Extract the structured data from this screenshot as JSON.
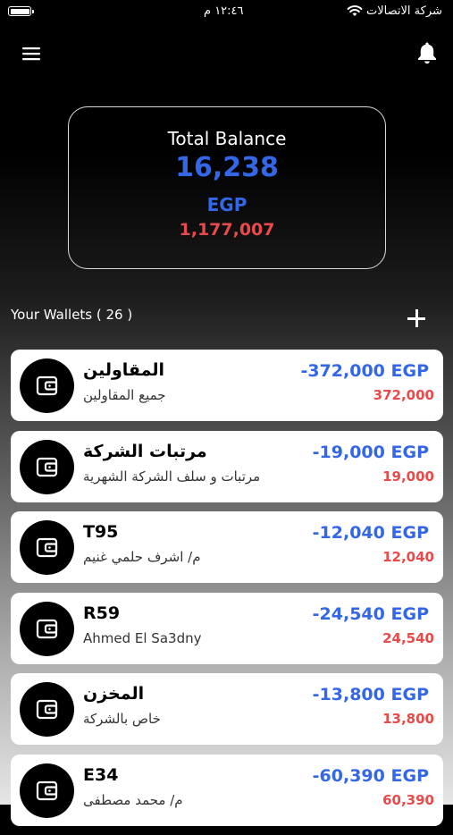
{
  "status_bar": {
    "carrier": "شركة الاتصالات",
    "time": "١٢:٤٦ م"
  },
  "balance": {
    "title": "Total Balance",
    "amount": "16,238",
    "currency": "EGP",
    "secondary": "1,177,007"
  },
  "wallets": {
    "title": "Your Wallets ( 26 )",
    "items": [
      {
        "name": "المقاولين",
        "description": "جميع المقاولين",
        "amount": "-372,000 EGP",
        "secondary": "372,000"
      },
      {
        "name": "مرتبات الشركة",
        "description": "مرتبات و سلف الشركة الشهرية",
        "amount": "-19,000 EGP",
        "secondary": "19,000"
      },
      {
        "name": "T95",
        "description": "م/ اشرف حلمي غنيم",
        "amount": "-12,040 EGP",
        "secondary": "12,040"
      },
      {
        "name": "R59",
        "description": "Ahmed El Sa3dny",
        "amount": "-24,540 EGP",
        "secondary": "24,540"
      },
      {
        "name": "المخزن",
        "description": "خاص بالشركة",
        "amount": "-13,800 EGP",
        "secondary": "13,800"
      },
      {
        "name": "E34",
        "description": "م/ محمد مصطفى",
        "amount": "-60,390 EGP",
        "secondary": "60,390"
      }
    ]
  },
  "icons": {
    "menu": "menu-icon",
    "notifications": "bell-icon",
    "add": "plus-icon",
    "wallet": "wallet-icon"
  },
  "colors": {
    "accent_blue": "#3467e8",
    "negative_red": "#e94a4a"
  }
}
